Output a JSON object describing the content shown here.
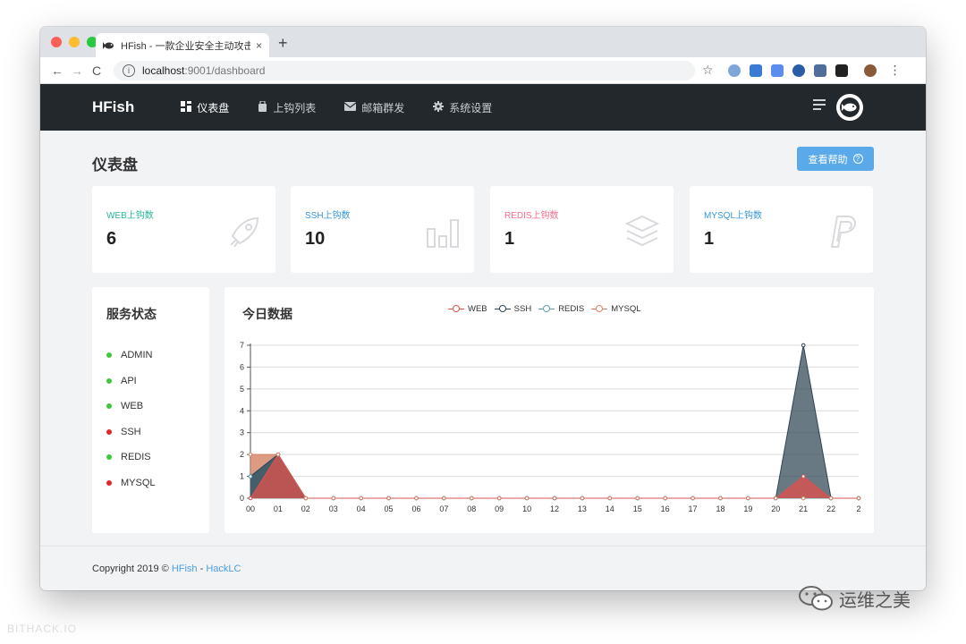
{
  "browser": {
    "tab_title": "HFish - 一款企业安全主动攻击!",
    "tab_close": "×",
    "new_tab": "+",
    "back": "←",
    "forward": "→",
    "reload": "C",
    "info_icon": "i",
    "url_host": "localhost",
    "url_path": ":9001/dashboard",
    "bookmark": "☆",
    "menu": "⋮"
  },
  "nav": {
    "brand": "HFish",
    "items": [
      {
        "label": "仪表盘",
        "icon": "dashboard-icon",
        "active": true
      },
      {
        "label": "上钩列表",
        "icon": "list-icon",
        "active": false
      },
      {
        "label": "邮箱群发",
        "icon": "mail-icon",
        "active": false
      },
      {
        "label": "系统设置",
        "icon": "gear-icon",
        "active": false
      }
    ]
  },
  "page": {
    "title": "仪表盘",
    "help_label": "查看帮助",
    "help_icon": "?"
  },
  "stats": [
    {
      "label": "WEB上钩数",
      "value": "6",
      "color": "#26b99a",
      "icon": "rocket-icon"
    },
    {
      "label": "SSH上钩数",
      "value": "10",
      "color": "#3498db",
      "icon": "bar-chart-icon"
    },
    {
      "label": "REDIS上钩数",
      "value": "1",
      "color": "#ff6b8b",
      "icon": "layers-icon"
    },
    {
      "label": "MYSQL上钩数",
      "value": "1",
      "color": "#3498db",
      "icon": "paypal-icon"
    }
  ],
  "services": {
    "title": "服务状态",
    "items": [
      {
        "name": "ADMIN",
        "status_color": "#3fc93a"
      },
      {
        "name": "API",
        "status_color": "#3fc93a"
      },
      {
        "name": "WEB",
        "status_color": "#3fc93a"
      },
      {
        "name": "SSH",
        "status_color": "#e0282c"
      },
      {
        "name": "REDIS",
        "status_color": "#3fc93a"
      },
      {
        "name": "MYSQL",
        "status_color": "#e0282c"
      }
    ]
  },
  "chart_data": {
    "type": "area",
    "title": "今日数据",
    "categories": [
      "00",
      "01",
      "02",
      "03",
      "04",
      "05",
      "06",
      "07",
      "08",
      "09",
      "10",
      "12",
      "13",
      "14",
      "15",
      "16",
      "17",
      "18",
      "19",
      "20",
      "21",
      "22",
      "2"
    ],
    "ylim": [
      0,
      7
    ],
    "yticks": [
      "0",
      "1",
      "2",
      "3",
      "4",
      "5",
      "6",
      "7"
    ],
    "grid": true,
    "legend_position": "top-center",
    "series": [
      {
        "name": "WEB",
        "color": "#d9534f",
        "values": [
          0,
          2,
          0,
          0,
          0,
          0,
          0,
          0,
          0,
          0,
          0,
          0,
          0,
          0,
          0,
          0,
          0,
          0,
          0,
          0,
          1,
          0,
          0
        ]
      },
      {
        "name": "SSH",
        "color": "#2f4554",
        "values": [
          1,
          2,
          0,
          0,
          0,
          0,
          0,
          0,
          0,
          0,
          0,
          0,
          0,
          0,
          0,
          0,
          0,
          0,
          0,
          0,
          7,
          0,
          0
        ]
      },
      {
        "name": "REDIS",
        "color": "#61a0a8",
        "values": [
          1,
          2,
          0,
          0,
          0,
          0,
          0,
          0,
          0,
          0,
          0,
          0,
          0,
          0,
          0,
          0,
          0,
          0,
          0,
          0,
          0,
          0,
          0
        ]
      },
      {
        "name": "MYSQL",
        "color": "#d48265",
        "values": [
          2,
          2,
          0,
          0,
          0,
          0,
          0,
          0,
          0,
          0,
          0,
          0,
          0,
          0,
          0,
          0,
          0,
          0,
          0,
          0,
          0,
          0,
          0
        ]
      }
    ]
  },
  "footer": {
    "text": "Copyright 2019 ©",
    "link1": "HFish",
    "sep": " - ",
    "link2": "HackLC"
  },
  "overlay": {
    "wechat_text": "运维之美",
    "watermark": "BITHACK.IO"
  }
}
